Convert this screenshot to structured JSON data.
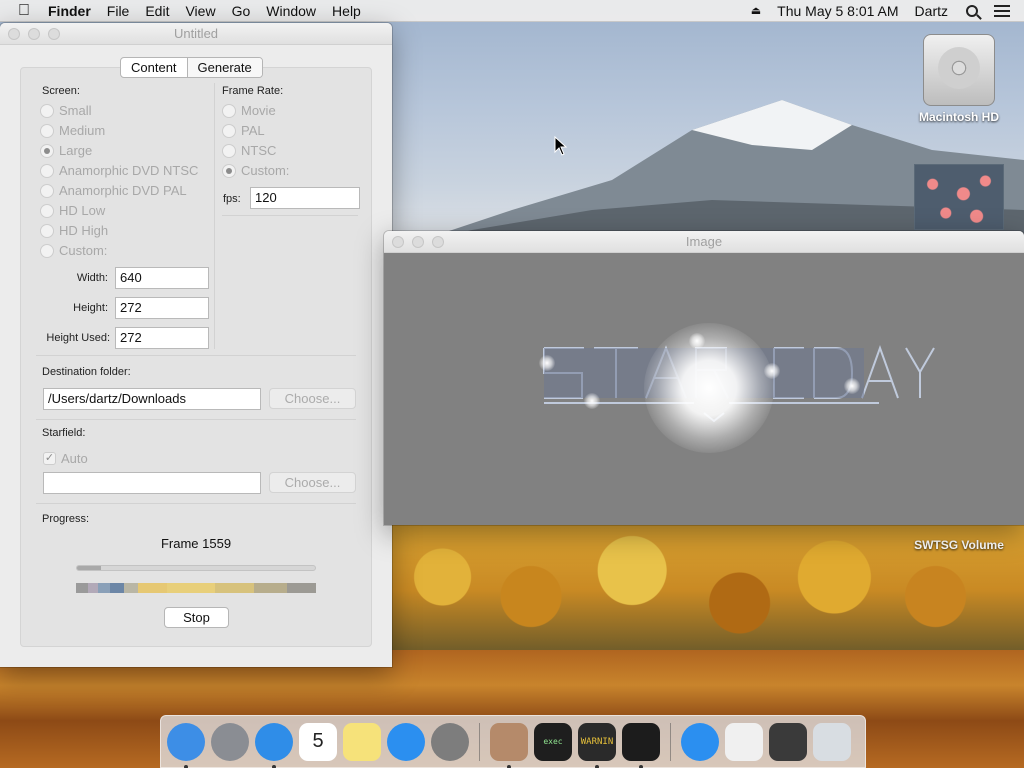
{
  "menubar": {
    "app_name": "Finder",
    "menus": [
      "File",
      "Edit",
      "View",
      "Go",
      "Window",
      "Help"
    ],
    "clock": "Thu May 5  8:01 AM",
    "user": "Dartz"
  },
  "desktop": {
    "icons": [
      {
        "label": "Macintosh HD"
      },
      {
        "label": "SWTSG Volume"
      }
    ]
  },
  "untitled_window": {
    "title": "Untitled",
    "tabs": [
      {
        "label": "Content",
        "selected": true
      },
      {
        "label": "Generate",
        "selected": false
      }
    ],
    "screen": {
      "heading": "Screen:",
      "options": [
        {
          "label": "Small",
          "selected": false
        },
        {
          "label": "Medium",
          "selected": false
        },
        {
          "label": "Large",
          "selected": true
        },
        {
          "label": "Anamorphic DVD NTSC",
          "selected": false
        },
        {
          "label": "Anamorphic DVD PAL",
          "selected": false
        },
        {
          "label": "HD Low",
          "selected": false
        },
        {
          "label": "HD High",
          "selected": false
        },
        {
          "label": "Custom:",
          "selected": false
        }
      ],
      "width_label": "Width:",
      "width_value": "640",
      "height_label": "Height:",
      "height_value": "272",
      "height_used_label": "Height Used:",
      "height_used_value": "272"
    },
    "frame_rate": {
      "heading": "Frame Rate:",
      "options": [
        {
          "label": "Movie",
          "selected": false
        },
        {
          "label": "PAL",
          "selected": false
        },
        {
          "label": "NTSC",
          "selected": false
        },
        {
          "label": "Custom:",
          "selected": true
        }
      ],
      "fps_label": "fps:",
      "fps_value": "120"
    },
    "destination": {
      "heading": "Destination folder:",
      "path": "/Users/dartz/Downloads",
      "choose_label": "Choose..."
    },
    "starfield": {
      "heading": "Starfield:",
      "auto_label": "Auto",
      "auto_checked": true,
      "path": "",
      "choose_label": "Choose..."
    },
    "progress": {
      "heading": "Progress:",
      "frame_text": "Frame 1559",
      "fraction": 0.1,
      "strip_colors": [
        "#9a9a9a",
        "#b2a9b8",
        "#8aa0b8",
        "#6c86a6",
        "#b9b6a5",
        "#e6c873",
        "#e8cf7a",
        "#d7c27c",
        "#b7ad8c",
        "#9c9a94"
      ]
    },
    "stop_label": "Stop"
  },
  "image_window": {
    "title": "Image"
  },
  "dock": {
    "apps": [
      {
        "name": "Finder",
        "icon": "finder-icon",
        "color": "#3d8ee6",
        "running": true
      },
      {
        "name": "Launchpad",
        "icon": "rocket-icon",
        "color": "#8a8d93",
        "running": false
      },
      {
        "name": "Safari",
        "icon": "compass-icon",
        "color": "#2f8de8",
        "running": true
      },
      {
        "name": "Calendar",
        "icon": "calendar-icon",
        "color": "#ffffff",
        "running": false,
        "text": "5"
      },
      {
        "name": "Notes",
        "icon": "notes-icon",
        "color": "#f6e27a",
        "running": false
      },
      {
        "name": "App Store",
        "icon": "app-store-icon",
        "color": "#2b8ff0",
        "running": false
      },
      {
        "name": "System Preferences",
        "icon": "gear-icon",
        "color": "#7d7d7d",
        "running": false
      },
      {
        "name": "Automator",
        "icon": "robot-icon",
        "color": "#b58a6a",
        "running": true
      },
      {
        "name": "Terminal",
        "icon": "terminal-icon",
        "color": "#1e1e1e",
        "running": false,
        "text": "exec"
      },
      {
        "name": "Console",
        "icon": "console-icon",
        "color": "#2a2a2a",
        "running": true,
        "text": "WARNIN"
      },
      {
        "name": "Script Editor",
        "icon": "script-icon",
        "color": "#1c1c1c",
        "running": true
      },
      {
        "name": "App Store Downloads",
        "icon": "app-store-icon",
        "color": "#2b8ff0",
        "running": false
      },
      {
        "name": "Volume",
        "icon": "drive-icon",
        "color": "#f0f0f0",
        "running": false
      },
      {
        "name": "Disk Utility",
        "icon": "disk-icon",
        "color": "#3a3a3a",
        "running": false
      },
      {
        "name": "Trash",
        "icon": "trash-icon",
        "color": "#d8dde2",
        "running": false
      }
    ]
  }
}
